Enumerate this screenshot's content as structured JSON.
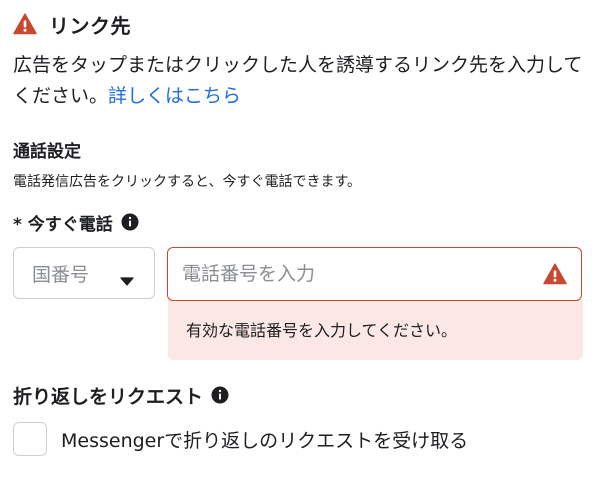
{
  "section": {
    "title": "リンク先",
    "description": "広告をタップまたはクリックした人を誘導するリンク先を入力してください。",
    "learn_more": "詳しくはこちら"
  },
  "call_settings": {
    "heading": "通話設定",
    "description": "電話発信広告をクリックすると、今すぐ電話できます。"
  },
  "call_now": {
    "label": "* 今すぐ電話",
    "country_select": {
      "placeholder": "国番号"
    },
    "phone_input": {
      "value": "",
      "placeholder": "電話番号を入力"
    },
    "error_message": "有効な電話番号を入力してください。"
  },
  "callback": {
    "heading": "折り返しをリクエスト",
    "checkbox_label": "Messengerで折り返しのリクエストを受け取る",
    "checked": false
  },
  "colors": {
    "warning": "#c8492f",
    "link": "#216fdb",
    "error_bg": "#fbe7e3",
    "border": "#ccd0d5"
  },
  "icons": {
    "section_warning": "warning-triangle-icon",
    "info": "info-circle-icon",
    "dropdown": "caret-down-icon",
    "field_warning": "warning-triangle-icon"
  }
}
